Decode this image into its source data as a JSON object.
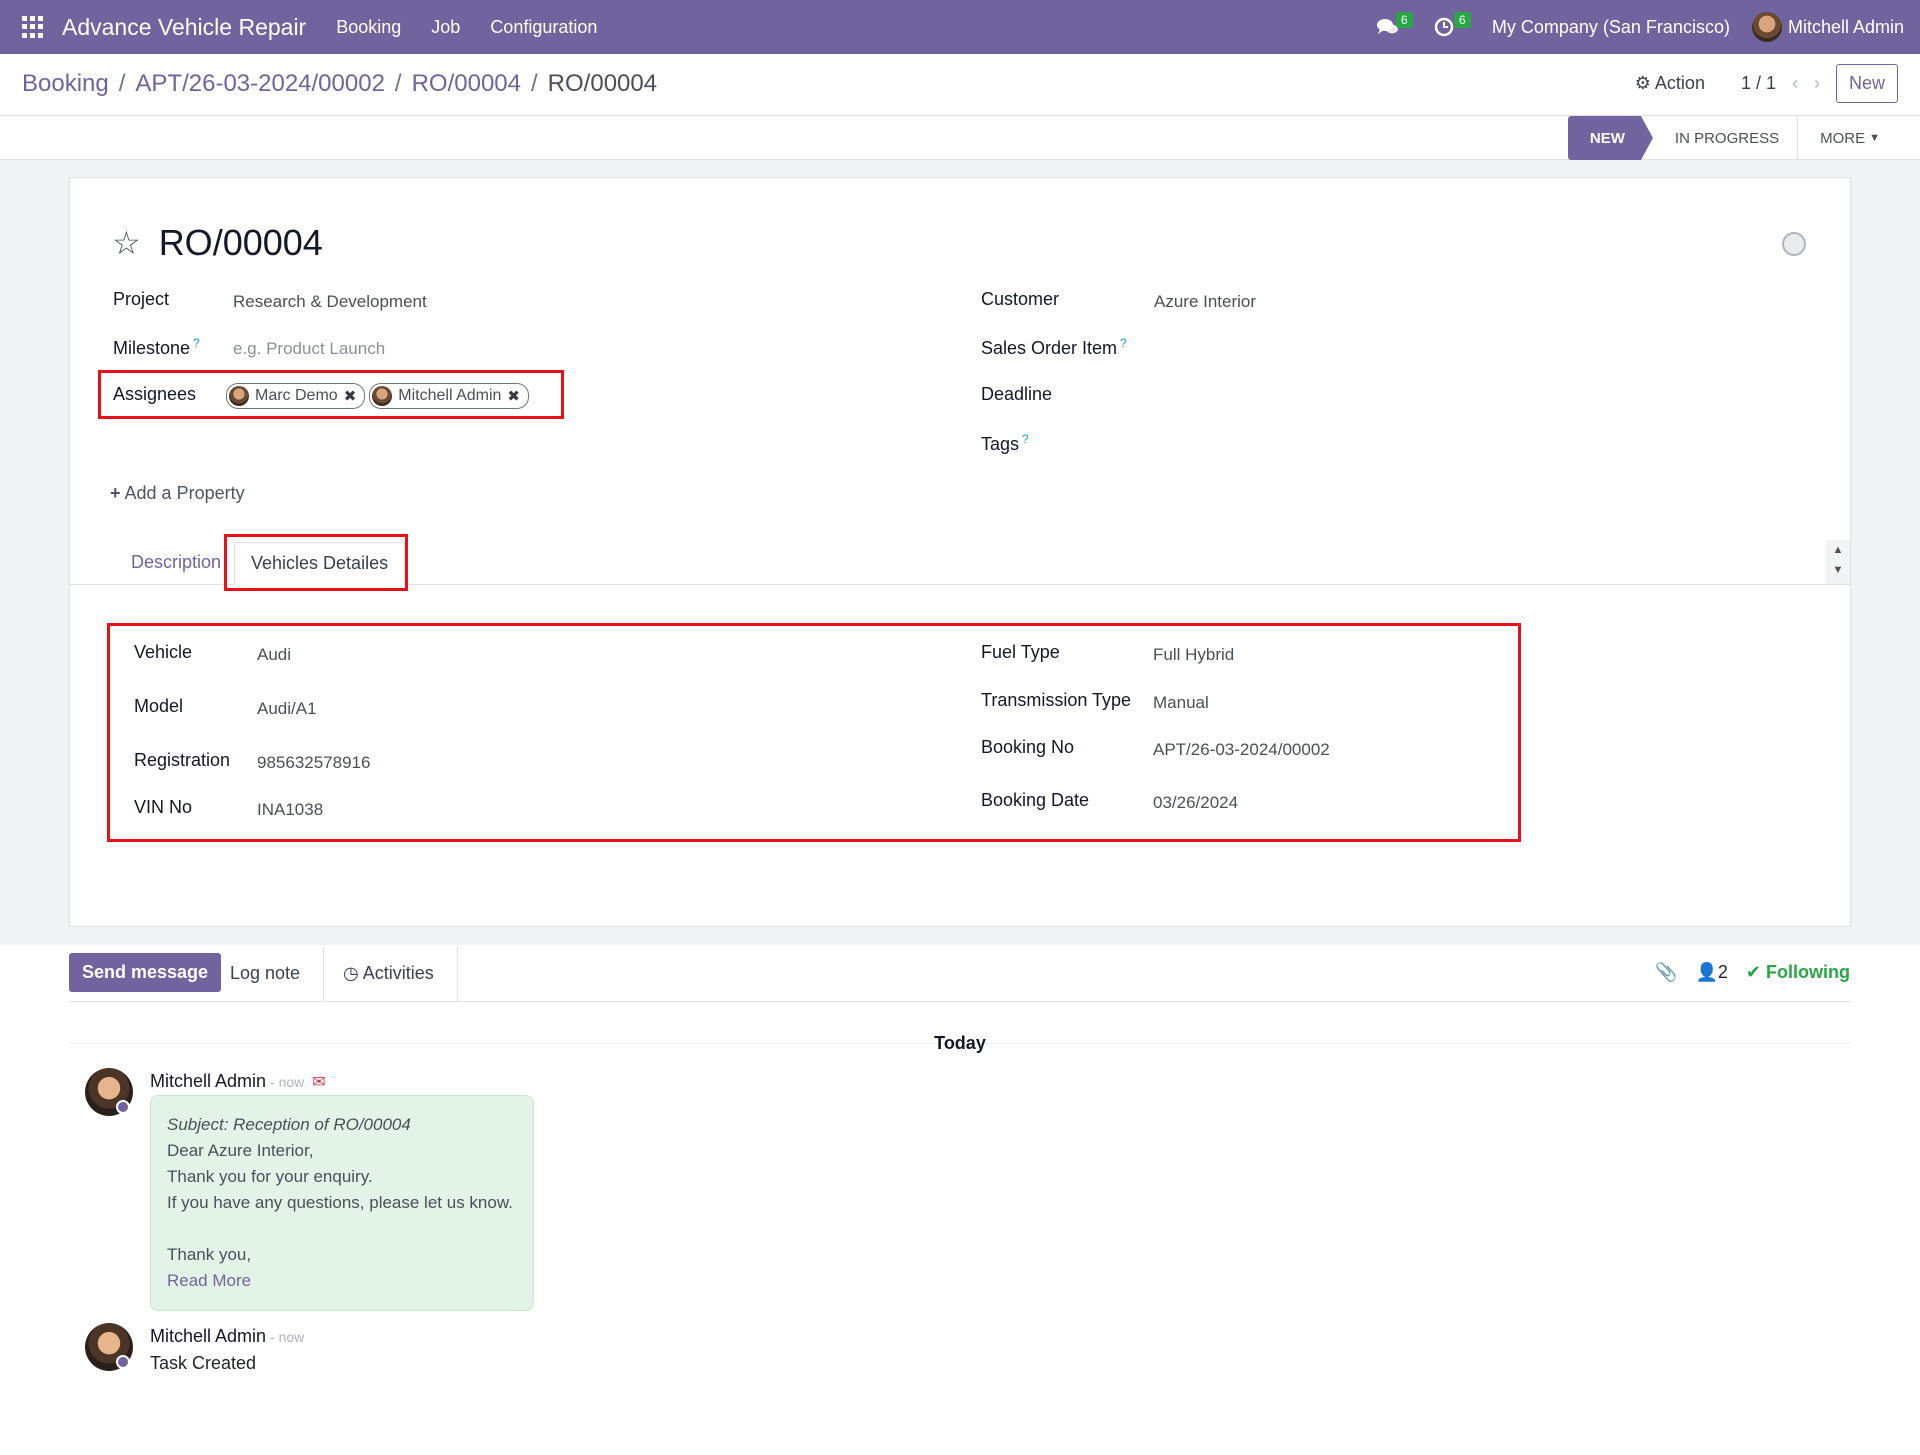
{
  "navbar": {
    "app_name": "Advance Vehicle Repair",
    "menu": [
      "Booking",
      "Job",
      "Configuration"
    ],
    "messages_count": "6",
    "activities_count": "6",
    "company": "My Company (San Francisco)",
    "user": "Mitchell Admin"
  },
  "breadcrumb": {
    "items": [
      "Booking",
      "APT/26-03-2024/00002",
      "RO/00004"
    ],
    "current": "RO/00004"
  },
  "control": {
    "action_label": "Action",
    "pager": "1 / 1",
    "new_label": "New"
  },
  "status": {
    "stages": [
      "NEW",
      "IN PROGRESS",
      "MORE"
    ],
    "active": "NEW"
  },
  "form": {
    "title": "RO/00004",
    "project_label": "Project",
    "project_value": "Research & Development",
    "milestone_label": "Milestone",
    "milestone_placeholder": "e.g. Product Launch",
    "assignees_label": "Assignees",
    "assignees": [
      "Marc Demo",
      "Mitchell Admin"
    ],
    "customer_label": "Customer",
    "customer_value": "Azure Interior",
    "sales_order_item_label": "Sales Order Item",
    "deadline_label": "Deadline",
    "tags_label": "Tags",
    "add_property": "Add a Property",
    "help_mark": "?"
  },
  "tabs": {
    "description": "Description",
    "vehicles": "Vehicles Detailes"
  },
  "vehicle": {
    "vehicle_label": "Vehicle",
    "vehicle_value": "Audi",
    "model_label": "Model",
    "model_value": "Audi/A1",
    "registration_label": "Registration",
    "registration_value": "985632578916",
    "vin_label": "VIN No",
    "vin_value": "INA1038",
    "fuel_label": "Fuel Type",
    "fuel_value": "Full Hybrid",
    "transmission_label": "Transmission Type",
    "transmission_value": "Manual",
    "booking_no_label": "Booking No",
    "booking_no_value": "APT/26-03-2024/00002",
    "booking_date_label": "Booking Date",
    "booking_date_value": "03/26/2024"
  },
  "chatter": {
    "send_message": "Send message",
    "log_note": "Log note",
    "activities": "Activities",
    "followers_count": "2",
    "following": "Following",
    "today": "Today",
    "messages": [
      {
        "author": "Mitchell Admin",
        "time": "- now",
        "subject": "Subject: Reception of RO/00004",
        "lines": [
          "Dear Azure Interior,",
          "Thank you for your enquiry.",
          "If you have any questions, please let us know.",
          "",
          "Thank you,"
        ],
        "read_more": "Read More"
      },
      {
        "author": "Mitchell Admin",
        "time": "- now",
        "body": "Task Created"
      }
    ]
  },
  "colors": {
    "brand": "#71639e",
    "highlight_box": "#e8101a",
    "success": "#28a745"
  }
}
